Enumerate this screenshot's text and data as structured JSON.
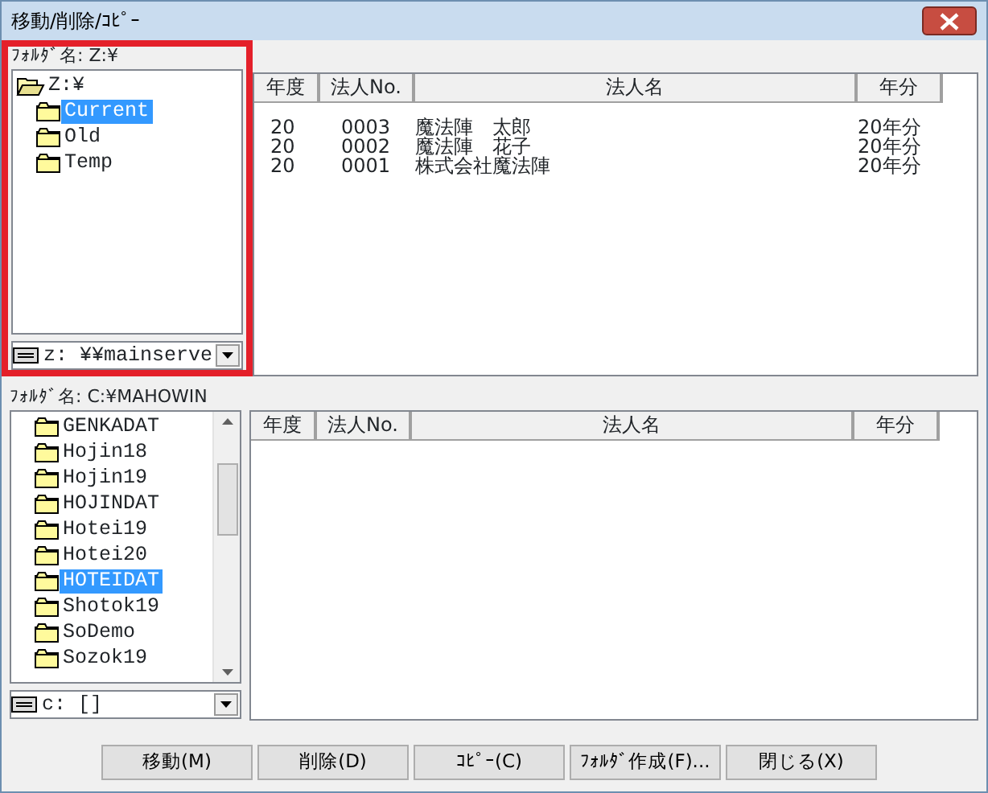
{
  "window": {
    "title": "移動/削除/ｺﾋﾟｰ"
  },
  "panes": [
    {
      "folder_label": "ﾌｫﾙﾀﾞ名: Z:¥",
      "highlighted": true,
      "scrollbar": false,
      "drive": "z: ¥¥mainserve",
      "tree": [
        {
          "label": "Z:¥",
          "kind": "open-folder",
          "selected": false,
          "children": [
            {
              "label": "Current",
              "kind": "folder",
              "selected": true
            },
            {
              "label": "Old",
              "kind": "folder",
              "selected": false
            },
            {
              "label": "Temp",
              "kind": "folder",
              "selected": false
            }
          ]
        }
      ],
      "columns": [
        "年度",
        "法人No.",
        "法人名",
        "年分"
      ],
      "rows": [
        [
          "20",
          "0003",
          "魔法陣　太郎",
          "20年分"
        ],
        [
          "20",
          "0002",
          "魔法陣　花子",
          "20年分"
        ],
        [
          "20",
          "0001",
          "株式会社魔法陣",
          "20年分"
        ]
      ]
    },
    {
      "folder_label": "ﾌｫﾙﾀﾞ名: C:¥MAHOWIN",
      "highlighted": false,
      "scrollbar": true,
      "drive": "c: []",
      "tree": [
        {
          "label": "GENKADAT",
          "kind": "folder",
          "selected": false
        },
        {
          "label": "Hojin18",
          "kind": "folder",
          "selected": false
        },
        {
          "label": "Hojin19",
          "kind": "folder",
          "selected": false
        },
        {
          "label": "HOJINDAT",
          "kind": "folder",
          "selected": false
        },
        {
          "label": "Hotei19",
          "kind": "folder",
          "selected": false
        },
        {
          "label": "Hotei20",
          "kind": "folder",
          "selected": false
        },
        {
          "label": "HOTEIDAT",
          "kind": "folder",
          "selected": true
        },
        {
          "label": "Shotok19",
          "kind": "folder",
          "selected": false
        },
        {
          "label": "SoDemo",
          "kind": "folder",
          "selected": false
        },
        {
          "label": "Sozok19",
          "kind": "folder",
          "selected": false
        }
      ],
      "columns": [
        "年度",
        "法人No.",
        "法人名",
        "年分"
      ]
    }
  ],
  "buttons": [
    "移動(M)",
    "削除(D)",
    "ｺﾋﾟｰ(C)",
    "ﾌｫﾙﾀﾞ作成(F)...",
    "閉じる(X)"
  ]
}
